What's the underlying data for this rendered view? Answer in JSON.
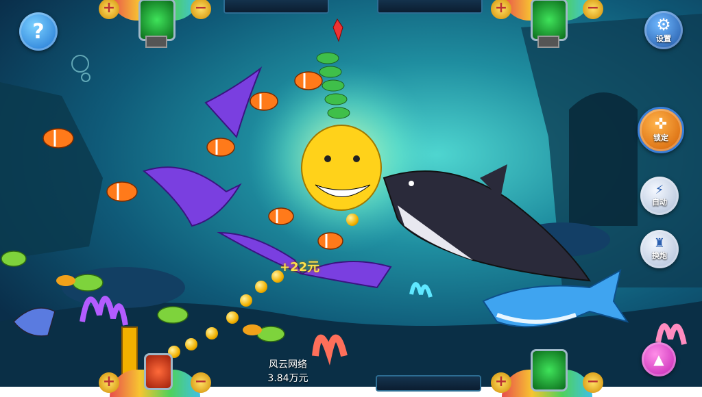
{
  "top_bar": {
    "left_turret": {
      "plus": "+",
      "minus": "−"
    },
    "right_turret": {
      "plus": "+",
      "minus": "−"
    }
  },
  "buttons": {
    "help": "?",
    "settings": "设置",
    "lock": "锁定",
    "auto": "自动",
    "switch_cannon": "换炮"
  },
  "reward_popup": "+22元",
  "player": {
    "name": "风云网络",
    "score": "3.84万元"
  },
  "bottom_bar": {
    "left_turret": {
      "plus": "+",
      "minus": "−"
    },
    "right_turret": {
      "plus": "+",
      "minus": "−"
    }
  },
  "colors": {
    "water": "#1f8ea0",
    "manta": "#7a3fe0",
    "yellow_shark": "#ffd21a",
    "black_shark": "#2a2a3a",
    "blue_shark": "#3fa4f0",
    "clownfish": "#ff7a1a",
    "menu_arrow": "#e83ccf"
  }
}
